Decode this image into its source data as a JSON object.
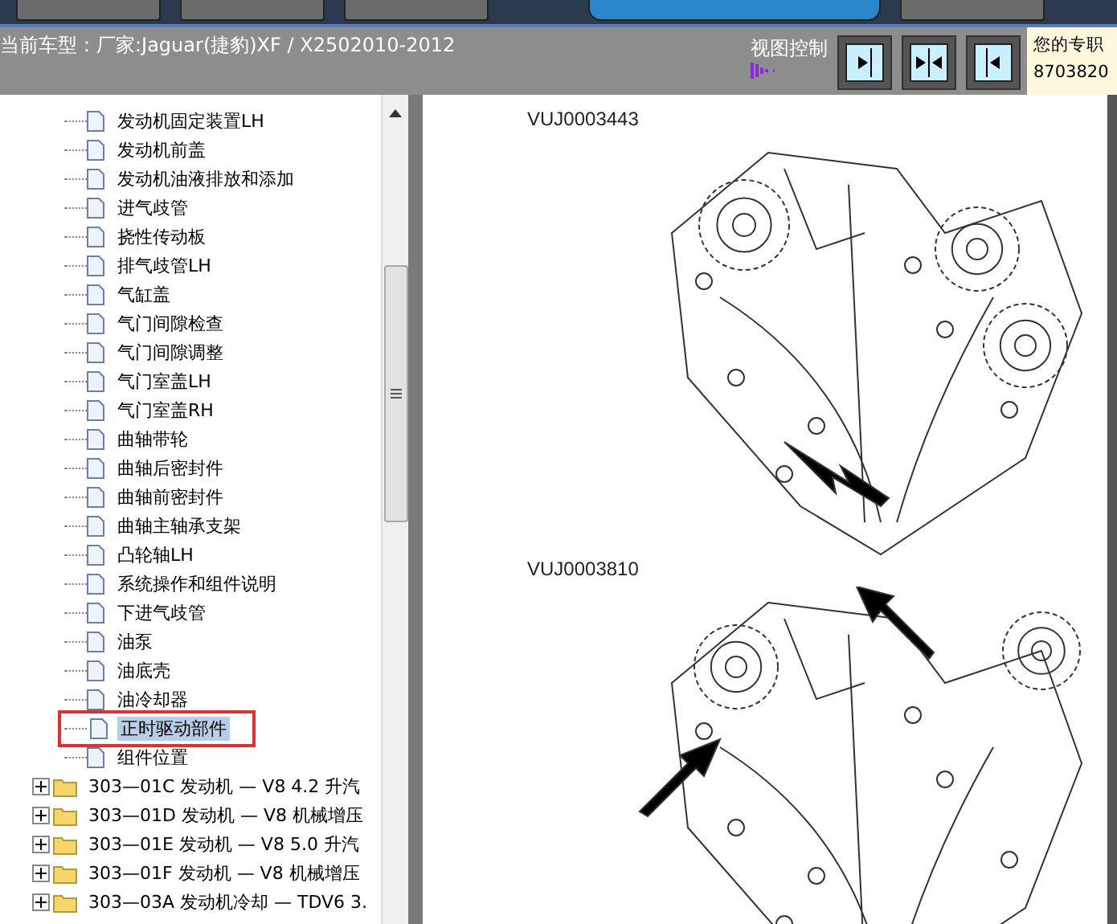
{
  "header": {
    "nav_tabs": [
      {
        "selected": false
      },
      {
        "selected": false
      },
      {
        "selected": false
      },
      {
        "selected": true
      },
      {
        "selected": false
      }
    ],
    "vehicle": "当前车型：厂家:Jaguar(捷豹)XF / X2502010-2012",
    "view_control": "视图控制",
    "user_label": "您的专职",
    "user_number": "8703820"
  },
  "tree": {
    "docs": [
      {
        "label": "发动机固定装置LH",
        "selected": false
      },
      {
        "label": "发动机前盖",
        "selected": false
      },
      {
        "label": "发动机油液排放和添加",
        "selected": false
      },
      {
        "label": "进气歧管",
        "selected": false
      },
      {
        "label": "挠性传动板",
        "selected": false
      },
      {
        "label": "排气歧管LH",
        "selected": false
      },
      {
        "label": "气缸盖",
        "selected": false
      },
      {
        "label": "气门间隙检查",
        "selected": false
      },
      {
        "label": "气门间隙调整",
        "selected": false
      },
      {
        "label": "气门室盖LH",
        "selected": false
      },
      {
        "label": "气门室盖RH",
        "selected": false
      },
      {
        "label": "曲轴带轮",
        "selected": false
      },
      {
        "label": "曲轴后密封件",
        "selected": false
      },
      {
        "label": "曲轴前密封件",
        "selected": false
      },
      {
        "label": "曲轴主轴承支架",
        "selected": false
      },
      {
        "label": "凸轮轴LH",
        "selected": false
      },
      {
        "label": "系统操作和组件说明",
        "selected": false
      },
      {
        "label": "下进气歧管",
        "selected": false
      },
      {
        "label": "油泵",
        "selected": false
      },
      {
        "label": "油底壳",
        "selected": false
      },
      {
        "label": "油冷却器",
        "selected": false
      },
      {
        "label": "正时驱动部件",
        "selected": true
      },
      {
        "label": "组件位置",
        "selected": false
      }
    ],
    "folders": [
      {
        "label": "303—01C 发动机 — V8 4.2 升汽",
        "expanded": false
      },
      {
        "label": "303—01D 发动机 — V8 机械增压",
        "expanded": false
      },
      {
        "label": "303—01E 发动机 — V8 5.0 升汽",
        "expanded": false
      },
      {
        "label": "303—01F 发动机 — V8 机械增压",
        "expanded": false
      },
      {
        "label": "303—03A 发动机冷却 — TDV6 3.",
        "expanded": false
      }
    ]
  },
  "content": {
    "figures": [
      {
        "caption": "VUJ0003443"
      },
      {
        "caption": "VUJ0003810"
      }
    ]
  }
}
